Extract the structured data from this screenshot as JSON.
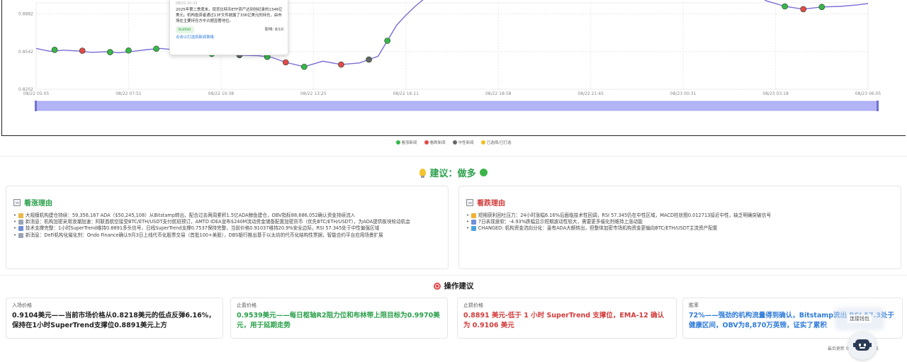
{
  "colors": {
    "positive": "#3ab54a",
    "negative": "#e24a4a",
    "neutral": "#666666",
    "selected": "#f0c020",
    "line": "#7a6fd6",
    "slider": "#b3b4f5"
  },
  "chart_data": {
    "type": "line",
    "y_ticks": [
      "0.8882",
      "0.8542",
      "0.8202"
    ],
    "y_range": [
      0.8202,
      0.8982
    ],
    "x_ticks": [
      "08/22 05:05",
      "08/22 07:51",
      "08/22 10:38",
      "08/22 13:25",
      "08/22 16:11",
      "08/22 18:58",
      "08/22 21:45",
      "08/23 00:31",
      "08/23 03:18",
      "08/23 06:05"
    ],
    "series": [
      {
        "x": [
          0,
          0.15,
          0.3,
          0.45,
          0.6,
          0.75,
          0.9,
          1.05,
          1.2,
          1.35,
          1.5,
          1.65,
          1.8,
          1.95,
          2.1,
          2.25,
          2.4,
          2.55,
          2.7,
          2.9,
          3.1,
          3.3,
          3.5,
          3.7,
          3.8,
          3.9,
          4.0,
          4.1,
          4.2,
          4.3,
          4.4,
          4.5,
          4.7,
          4.9,
          5.1,
          5.3,
          5.5,
          5.7,
          5.9,
          6.1,
          6.3,
          6.5,
          6.7,
          6.9,
          7.1,
          7.3,
          7.5,
          7.7,
          7.9,
          8.1,
          8.3,
          8.5,
          8.7,
          8.9,
          9.0
        ],
        "y": [
          0.857,
          0.8545,
          0.8555,
          0.8548,
          0.8535,
          0.854,
          0.8532,
          0.8545,
          0.856,
          0.857,
          0.8558,
          0.854,
          0.8525,
          0.852,
          0.8515,
          0.8508,
          0.8505,
          0.849,
          0.8445,
          0.8405,
          0.8455,
          0.8425,
          0.844,
          0.85,
          0.864,
          0.878,
          0.887,
          0.895,
          0.902,
          0.906,
          0.91,
          0.914,
          0.92,
          0.925,
          0.93,
          0.935,
          0.94,
          0.942,
          0.945,
          0.948,
          0.95,
          0.948,
          0.945,
          0.942,
          0.938,
          0.93,
          0.92,
          0.91,
          0.9,
          0.895,
          0.8925,
          0.8945,
          0.895,
          0.8965,
          0.8975
        ]
      }
    ],
    "markers": [
      {
        "x": 0.2,
        "y": 0.8558,
        "t": "pos"
      },
      {
        "x": 0.5,
        "y": 0.855,
        "t": "neg"
      },
      {
        "x": 0.8,
        "y": 0.8537,
        "t": "pos"
      },
      {
        "x": 1.0,
        "y": 0.8552,
        "t": "pos"
      },
      {
        "x": 1.3,
        "y": 0.8568,
        "t": "pos"
      },
      {
        "x": 1.6,
        "y": 0.8545,
        "t": "neg"
      },
      {
        "x": 1.9,
        "y": 0.8522,
        "t": "pos"
      },
      {
        "x": 2.2,
        "y": 0.851,
        "t": "neu"
      },
      {
        "x": 2.5,
        "y": 0.8495,
        "t": "pos"
      },
      {
        "x": 2.7,
        "y": 0.8445,
        "t": "neg"
      },
      {
        "x": 2.9,
        "y": 0.8405,
        "t": "pos"
      },
      {
        "x": 3.3,
        "y": 0.8425,
        "t": "neg"
      },
      {
        "x": 3.6,
        "y": 0.847,
        "t": "neu"
      },
      {
        "x": 3.8,
        "y": 0.864,
        "t": "pos"
      },
      {
        "x": 8.1,
        "y": 0.895,
        "t": "pos"
      },
      {
        "x": 8.3,
        "y": 0.8925,
        "t": "neg"
      },
      {
        "x": 8.5,
        "y": 0.8945,
        "t": "pos"
      }
    ],
    "legend": [
      "看涨新闻",
      "看跌新闻",
      "中性新闻",
      "已选择/已打选"
    ],
    "legend_placement": "bottom-center",
    "grid": true
  },
  "tooltip": {
    "date": "08/22 10:33",
    "text": "2025年第二季度末，现货比特币ETF资产达到创纪录的1346亿美元。机构投资者通过13F文件披露了336亿美元的持仓，由市场在主要持仓方中占据显著地位。",
    "badge": "bullish",
    "impact": "影响: 8/10",
    "link": "点击以打选到新闻事格"
  },
  "recommendation": {
    "label": "建议：做多"
  },
  "bull": {
    "title": "看涨理由",
    "items": [
      "大规模机构建仓持续：59,356,167 ADA（$50,245,108）从Bitstamp转出，配合过去两周累积1.5亿ADA鲸鱼建仓，OBV指标88,686,052确认资金持续流入",
      "新消息：机构加密采用浪潮加速：阿联酋航空接受BTC/ETH/USDT支付航班预订，AMTD IDEA宣布$240M流动资金储备配置加密货币（优先BTC/ETH/USDT），为ADA提供板块轮动机会",
      "技术支撑完整：1小时SuperTrend维持0.8891多头信号，日线SuperTrend支撑0.7537保持完整，当前价格0.91037维持20.9%安全边际，RSI 57.345处于中性偏强区域",
      "新消息：DeFi机构化催化剂：Ondo Finance确认9月3日上线代币化股票交易（首批100+美股），DBS银行推出基于以太坊的代币化结构性票据，智能合约平台应用场景扩展"
    ]
  },
  "bear": {
    "title": "看跌理由",
    "items": [
      "短期获利回吐压力：24小时涨幅6.16%后面临技术性回调，RSI 57.345仍在中性区域，MACD柱状图0.012713接近中性，缺乏明确突破信号",
      "7日表现疲软：-4.93%跌幅显示短期波动性较大，需要更多催化剂维持上涨动能",
      "CHANGED: 机构资金流向分化：虽有ADA大额转出，但整体加密市场机构资金更偏向BTC/ETH/USDT主流资产配置"
    ]
  },
  "ops": {
    "title": "操作建议",
    "entry": {
      "label": "入场价格",
      "value": "0.9104美元——当前市场价格从0.8218美元的低点反弹6.16%，保持在1小时SuperTrend支撑位0.8891美元上方"
    },
    "take_profit": {
      "label": "止盈价格",
      "value": "0.9539美元——每日枢轴R2阻力位和布林带上限目标为0.9970美元，用于延期走势"
    },
    "stop_loss": {
      "label": "止损价格",
      "value": "0.8891 美元-低于 1 小时 SuperTrend 支撑位，EMA-12 确认为 0.9106 美元"
    },
    "win_rate": {
      "label": "胜率",
      "value": "72%——强劲的机构流量得到确认，Bitstamp流出 RSI 57.3处于健康区间，OBV为8,870万英镑，证实了累积"
    }
  },
  "wallet_button": "连接钱包",
  "footer_time": "最后更新 08/23 12:54:05"
}
